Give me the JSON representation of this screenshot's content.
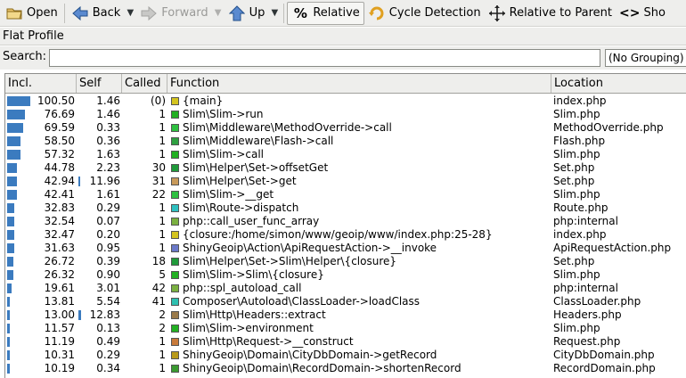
{
  "toolbar": {
    "open": "Open",
    "back": "Back",
    "forward": "Forward",
    "up": "Up",
    "relative": "Relative",
    "cycle_detection": "Cycle Detection",
    "relative_to_parent": "Relative to Parent",
    "show": "Sho"
  },
  "panel_title": "Flat Profile",
  "search": {
    "label": "Search:",
    "value": ""
  },
  "grouping": {
    "selected": "(No Grouping)"
  },
  "columns": {
    "incl": "Incl.",
    "self": "Self",
    "called": "Called",
    "function": "Function",
    "location": "Location"
  },
  "colors": {
    "bar": "#3b7bbf",
    "accent": "#3465a4"
  },
  "rows": [
    {
      "incl": "100.50",
      "self": "1.46",
      "called": "(0)",
      "function": "{main}",
      "location": "index.php",
      "swatch": "#d4c41f",
      "incl_frac": 1.0,
      "self_frac": 0.0
    },
    {
      "incl": "76.69",
      "self": "1.46",
      "called": "1",
      "function": "Slim\\Slim->run",
      "location": "Slim.php",
      "swatch": "#22b022",
      "incl_frac": 0.76,
      "self_frac": 0.0
    },
    {
      "incl": "69.59",
      "self": "0.33",
      "called": "1",
      "function": "Slim\\Middleware\\MethodOverride->call",
      "location": "MethodOverride.php",
      "swatch": "#2ec040",
      "incl_frac": 0.69,
      "self_frac": 0.0
    },
    {
      "incl": "58.50",
      "self": "0.36",
      "1": "",
      "called": "1",
      "function": "Slim\\Middleware\\Flash->call",
      "location": "Flash.php",
      "swatch": "#2ea040",
      "incl_frac": 0.58,
      "self_frac": 0.0
    },
    {
      "incl": "57.32",
      "self": "1.63",
      "called": "1",
      "function": "Slim\\Slim->call",
      "location": "Slim.php",
      "swatch": "#22b022",
      "incl_frac": 0.57,
      "self_frac": 0.0
    },
    {
      "incl": "44.78",
      "self": "2.23",
      "called": "30",
      "function": "Slim\\Helper\\Set->offsetGet",
      "location": "Set.php",
      "swatch": "#1f9a3a",
      "incl_frac": 0.44,
      "self_frac": 0.0
    },
    {
      "incl": "42.94",
      "self": "11.96",
      "called": "31",
      "function": "Slim\\Helper\\Set->get",
      "location": "Set.php",
      "swatch": "#c89a5a",
      "incl_frac": 0.42,
      "self_frac": 0.12
    },
    {
      "incl": "42.41",
      "self": "1.61",
      "called": "22",
      "function": "Slim\\Slim->__get",
      "location": "Slim.php",
      "swatch": "#2ec040",
      "incl_frac": 0.42,
      "self_frac": 0.0
    },
    {
      "incl": "32.83",
      "self": "0.29",
      "called": "1",
      "function": "Slim\\Route->dispatch",
      "location": "Route.php",
      "swatch": "#2ec0c0",
      "incl_frac": 0.32,
      "self_frac": 0.0
    },
    {
      "incl": "32.54",
      "self": "0.07",
      "called": "1",
      "function": "php::call_user_func_array",
      "location": "php:internal",
      "swatch": "#7ab040",
      "incl_frac": 0.32,
      "self_frac": 0.0
    },
    {
      "incl": "32.47",
      "self": "0.20",
      "called": "1",
      "function": "{closure:/home/simon/www/geoip/www/index.php:25-28}",
      "location": "index.php",
      "swatch": "#d4c41f",
      "incl_frac": 0.32,
      "self_frac": 0.0
    },
    {
      "incl": "31.63",
      "self": "0.95",
      "called": "1",
      "function": "ShinyGeoip\\Action\\ApiRequestAction->__invoke",
      "location": "ApiRequestAction.php",
      "swatch": "#6a78c8",
      "incl_frac": 0.31,
      "self_frac": 0.0
    },
    {
      "incl": "26.72",
      "self": "0.39",
      "called": "18",
      "function": "Slim\\Helper\\Set->Slim\\Helper\\{closure}",
      "location": "Set.php",
      "swatch": "#1f9a3a",
      "incl_frac": 0.26,
      "self_frac": 0.0
    },
    {
      "incl": "26.32",
      "self": "0.90",
      "called": "5",
      "function": "Slim\\Slim->Slim\\{closure}",
      "location": "Slim.php",
      "swatch": "#22b022",
      "incl_frac": 0.26,
      "self_frac": 0.0
    },
    {
      "incl": "19.61",
      "self": "3.01",
      "called": "42",
      "function": "php::spl_autoload_call",
      "location": "php:internal",
      "swatch": "#7ab040",
      "incl_frac": 0.19,
      "self_frac": 0.0
    },
    {
      "incl": "13.81",
      "self": "5.54",
      "called": "41",
      "function": "Composer\\Autoload\\ClassLoader->loadClass",
      "location": "ClassLoader.php",
      "swatch": "#2ec0b0",
      "incl_frac": 0.13,
      "self_frac": 0.0
    },
    {
      "incl": "13.00",
      "self": "12.83",
      "called": "2",
      "function": "Slim\\Http\\Headers::extract",
      "location": "Headers.php",
      "swatch": "#9a7a4a",
      "incl_frac": 0.13,
      "self_frac": 0.13
    },
    {
      "incl": "11.57",
      "self": "0.13",
      "called": "2",
      "function": "Slim\\Slim->environment",
      "location": "Slim.php",
      "swatch": "#22b022",
      "incl_frac": 0.11,
      "self_frac": 0.0
    },
    {
      "incl": "11.19",
      "self": "0.49",
      "called": "1",
      "function": "Slim\\Http\\Request->__construct",
      "location": "Request.php",
      "swatch": "#c87a3a",
      "incl_frac": 0.11,
      "self_frac": 0.0
    },
    {
      "incl": "10.31",
      "self": "0.29",
      "called": "1",
      "function": "ShinyGeoip\\Domain\\CityDbDomain->getRecord",
      "location": "CityDbDomain.php",
      "swatch": "#b89a1a",
      "incl_frac": 0.1,
      "self_frac": 0.0
    },
    {
      "incl": "10.19",
      "self": "0.34",
      "called": "1",
      "function": "ShinyGeoip\\Domain\\RecordDomain->shortenRecord",
      "location": "RecordDomain.php",
      "swatch": "#3a9a30",
      "incl_frac": 0.1,
      "self_frac": 0.0
    }
  ]
}
